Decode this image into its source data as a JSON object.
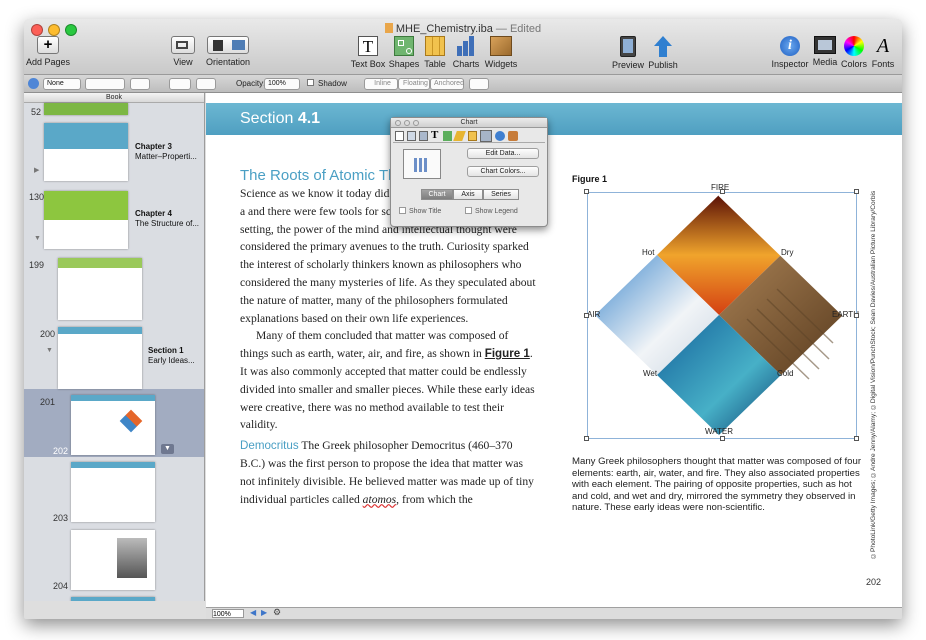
{
  "window": {
    "file_name": "MHE_Chemistry.iba",
    "edited": "— Edited"
  },
  "toolbar": {
    "add_pages": "Add Pages",
    "view": "View",
    "orientation": "Orientation",
    "text_box": "Text Box",
    "shapes": "Shapes",
    "table": "Table",
    "charts": "Charts",
    "widgets": "Widgets",
    "preview": "Preview",
    "publish": "Publish",
    "inspector": "Inspector",
    "media": "Media",
    "colors": "Colors",
    "fonts": "Fonts"
  },
  "format_bar": {
    "style_select": "None",
    "opacity_label": "Opacity:",
    "opacity_value": "100%",
    "shadow_label": "Shadow",
    "inline": "Inline",
    "floating": "Floating",
    "anchored": "Anchored"
  },
  "sidebar": {
    "header": "Book",
    "pages": [
      "52",
      "130",
      "199",
      "200",
      "201",
      "202",
      "203",
      "204"
    ],
    "chapter3_title": "Chapter 3",
    "chapter3_sub": "Matter–Properti...",
    "chapter4_title": "Chapter 4",
    "chapter4_sub": "The Structure of...",
    "section_title": "Section 1",
    "section_sub": "Early Ideas..."
  },
  "page": {
    "section_prefix": "Section ",
    "section_number": "4.1",
    "heading": "The Roots of Atomic Th",
    "p1": "Science as we know it today did years ago. No one knew what a and there were few tools for scientific exploration. In this setting, the power of the mind and intellectual thought were considered the primary avenues to the truth. Curiosity sparked the interest of scholarly thinkers known as philosophers who considered the many mysteries of life. As they speculated about the nature of matter, many of the philosophers formulated explanations based on their own life experiences.",
    "p2_a": "Many of them concluded that matter was composed of things such as earth, water, air, and fire, as shown in ",
    "p2_link": "Figure 1",
    "p2_b": ". It was also commonly accepted that matter could be endlessly divided into smaller and smaller pieces. While these early ideas were creative, there was no method available to test their validity.",
    "p3_kw": "Democritus",
    "p3_a": "  The Greek philosopher Democritus (460–370 B.C.) was the first person to propose the idea that matter was not infinitely divisible. He believed matter was made up of tiny individual particles called ",
    "p3_em": "atomos",
    "p3_b": ", from which the",
    "figure_label": "Figure 1",
    "caption": "Many Greek philosophers thought that matter was composed of four elements: earth, air, water, and fire. They also associated properties with each element. The pairing of opposite properties, such as hot and cold, and wet and dry, mirrored the symmetry they observed in nature. These early ideas were non-scientific.",
    "credit": "©PhotoLink/Getty Images; ©Andre Jenny/Alamy; ©Digital Vision/PunchStock; Sean Davies/Australian Picture Library/Corbis",
    "page_number": "202"
  },
  "diagram": {
    "top": "FIRE",
    "bottom": "WATER",
    "left": "AIR",
    "right": "EARTH",
    "hot": "Hot",
    "dry": "Dry",
    "wet": "Wet",
    "cold": "Cold"
  },
  "chart_panel": {
    "title": "Chart",
    "edit_data": "Edit Data...",
    "chart_colors": "Chart Colors...",
    "tab_chart": "Chart",
    "tab_axis": "Axis",
    "tab_series": "Series",
    "show_title": "Show Title",
    "show_legend": "Show Legend"
  },
  "status": {
    "zoom": "100%"
  },
  "colors": {
    "accent": "#4a9fc4",
    "selection": "#a2acc1"
  }
}
